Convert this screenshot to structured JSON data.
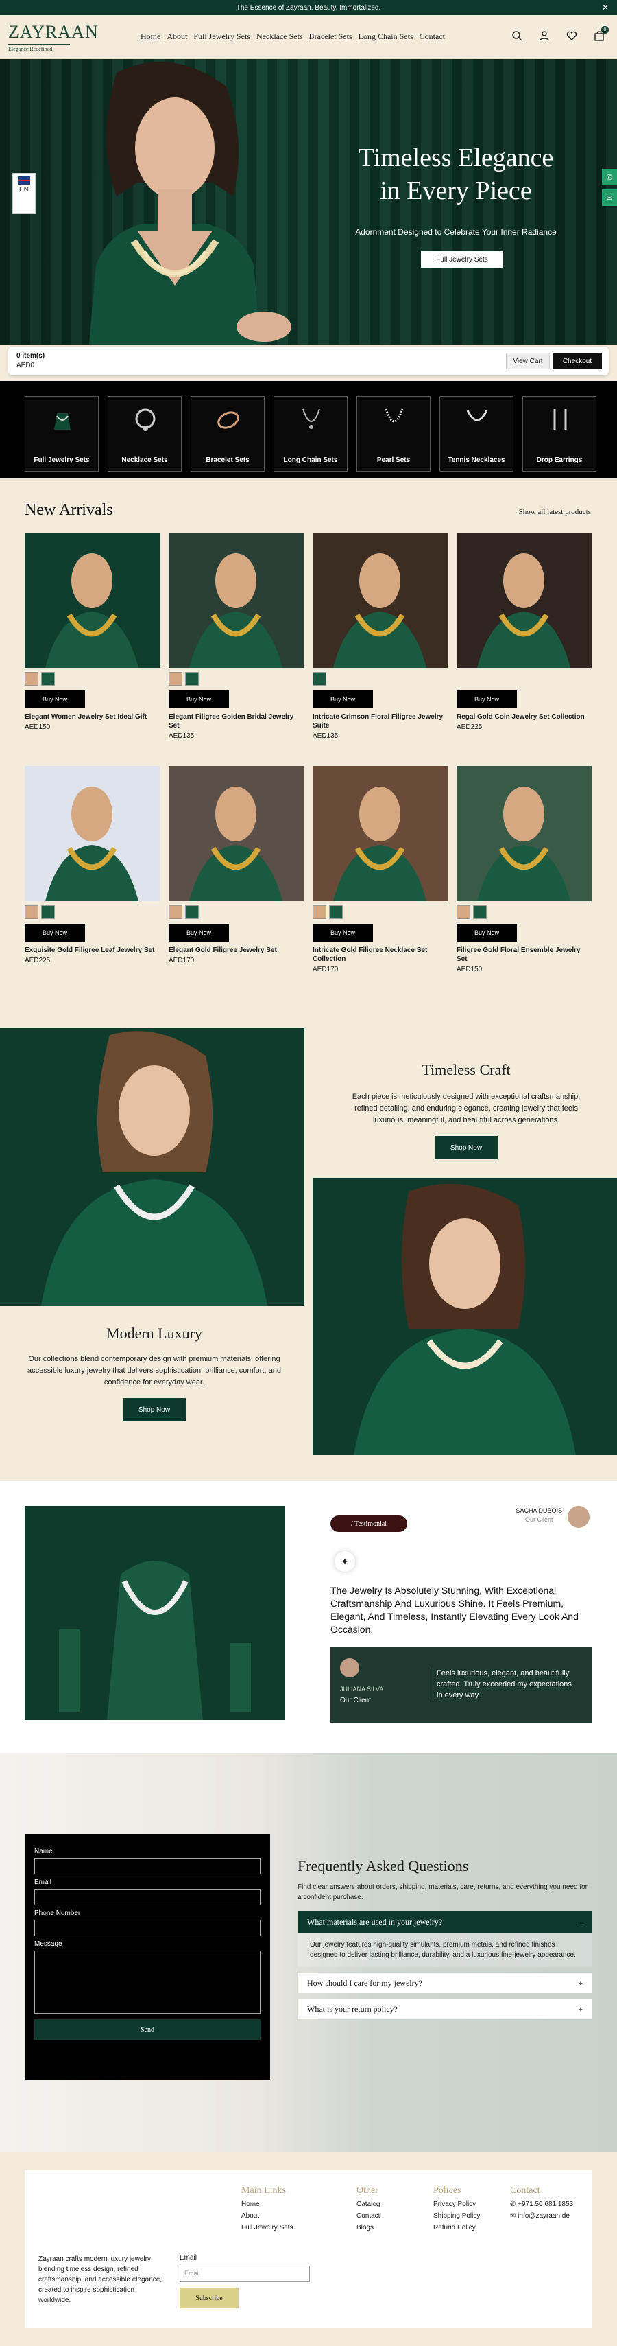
{
  "topbar": {
    "announcement": "The Essence of Zayraan. Beauty, Immortalized."
  },
  "header": {
    "brand": "ZAYRAAN",
    "tagline": "Elegance Redefined",
    "nav": [
      "Home",
      "About",
      "Full Jewelry Sets",
      "Necklace Sets",
      "Bracelet Sets",
      "Long Chain Sets",
      "Contact"
    ],
    "cart_count": "0"
  },
  "hero": {
    "title_line1": "Timeless Elegance",
    "title_line2": "in Every Piece",
    "subtitle": "Adornment Designed to Celebrate Your Inner Radiance",
    "cta": "Full Jewelry Sets",
    "lang": "EN"
  },
  "cartbar": {
    "items": "0 item(s)",
    "total": "AED0",
    "view_cart": "View Cart",
    "checkout": "Checkout"
  },
  "categories": [
    "Full Jewelry Sets",
    "Necklace Sets",
    "Bracelet Sets",
    "Long Chain Sets",
    "Pearl Sets",
    "Tennis Necklaces",
    "Drop Earrings"
  ],
  "new_arrivals": {
    "title": "New Arrivals",
    "link": "Show all latest products",
    "buy_label": "Buy Now",
    "products": [
      {
        "name": "Elegant Women Jewelry Set Ideal Gift",
        "price": "AED150"
      },
      {
        "name": "Elegant Filigree Golden Bridal Jewelry Set",
        "price": "AED135"
      },
      {
        "name": "Intricate Crimson Floral Filigree Jewelry Suite",
        "price": "AED135"
      },
      {
        "name": "Regal Gold Coin Jewelry Set Collection",
        "price": "AED225"
      },
      {
        "name": "Exquisite Gold Filigree Leaf Jewelry Set",
        "price": "AED225"
      },
      {
        "name": "Elegant Gold Filigree Jewelry Set",
        "price": "AED170"
      },
      {
        "name": "Intricate Gold Filigree Necklace Set Collection",
        "price": "AED170"
      },
      {
        "name": "Filigree Gold Floral Ensemble Jewelry Set",
        "price": "AED150"
      }
    ]
  },
  "timeless_craft": {
    "title": "Timeless Craft",
    "text": "Each piece is meticulously designed with exceptional craftsmanship, refined detailing, and enduring elegance, creating jewelry that feels luxurious, meaningful, and beautiful across generations.",
    "cta": "Shop Now"
  },
  "modern_luxury": {
    "title": "Modern Luxury",
    "text": "Our collections blend contemporary design with premium materials, offering accessible luxury jewelry that delivers sophistication, brilliance, comfort, and confidence for everyday wear.",
    "cta": "Shop Now"
  },
  "testimonial": {
    "pill": "/ Testimonial",
    "author_top": "SACHA DUBOIS",
    "author_top_role": "Our Client",
    "quote": "The Jewelry Is Absolutely Stunning, With Exceptional Craftsmanship And Luxurious Shine. It Feels Premium, Elegant, And Timeless, Instantly Elevating Every Look And Occasion.",
    "card_name": "JULIANA SILVA",
    "card_role": "Our Client",
    "card_text": "Feels luxurious, elegant, and beautifully crafted. Truly exceeded my expectations in every way."
  },
  "form": {
    "name": "Name",
    "email": "Email",
    "phone": "Phone Number",
    "message": "Message",
    "send": "Send"
  },
  "faq": {
    "title": "Frequently Asked Questions",
    "intro": "Find clear answers about orders, shipping, materials, care, returns, and everything you need for a confident purchase.",
    "q1": "What materials are used in your jewelry?",
    "a1": "Our jewelry features high-quality simulants, premium metals, and refined finishes designed to deliver lasting brilliance, durability, and a luxurious fine-jewelry appearance.",
    "q2": "How should I care for my jewelry?",
    "q3": "What is your return policy?"
  },
  "footer": {
    "main_title": "Main Links",
    "main_links": [
      "Home",
      "About",
      "Full Jewelry Sets"
    ],
    "other_title": "Other",
    "other_links": [
      "Catalog",
      "Contact",
      "Blogs"
    ],
    "policies_title": "Polices",
    "policies_links": [
      "Privacy Policy",
      "Shipping Policy",
      "Refund Policy"
    ],
    "contact_title": "Contact",
    "phone": "+971 50 681 1853",
    "email": "info@zayraan.de",
    "about": "Zayraan crafts modern luxury jewelry blending timeless design, refined craftsmanship, and accessible elegance, created to inspire sophistication worldwide.",
    "email_label": "Email",
    "email_placeholder": "Email",
    "subscribe": "Subscribe"
  },
  "colors": {
    "primary": "#0d3a2c",
    "background": "#f3ecdd",
    "accent_gold": "#b8a27a"
  }
}
